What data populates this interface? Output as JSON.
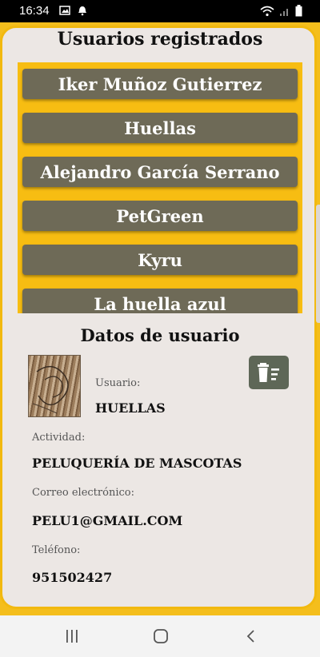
{
  "status_bar": {
    "time": "16:34"
  },
  "list_title": "Usuarios registrados",
  "users": [
    "Iker Muñoz Gutierrez",
    "Huellas",
    "Alejandro García Serrano",
    "PetGreen",
    "Kyru",
    "La huella azul"
  ],
  "detail": {
    "title": "Datos de usuario",
    "username_label": "Usuario:",
    "username": "HUELLAS",
    "activity_label": "Actividad:",
    "activity": "PELUQUERÍA DE MASCOTAS",
    "email_label": "Correo electrónico:",
    "email": "PELU1@GMAIL.COM",
    "phone_label": "Teléfono:",
    "phone": "951502427"
  },
  "colors": {
    "accent": "#f4be1c",
    "list_item": "#6e6a57",
    "delete_button": "#5e6757",
    "card": "#ece7e4"
  }
}
